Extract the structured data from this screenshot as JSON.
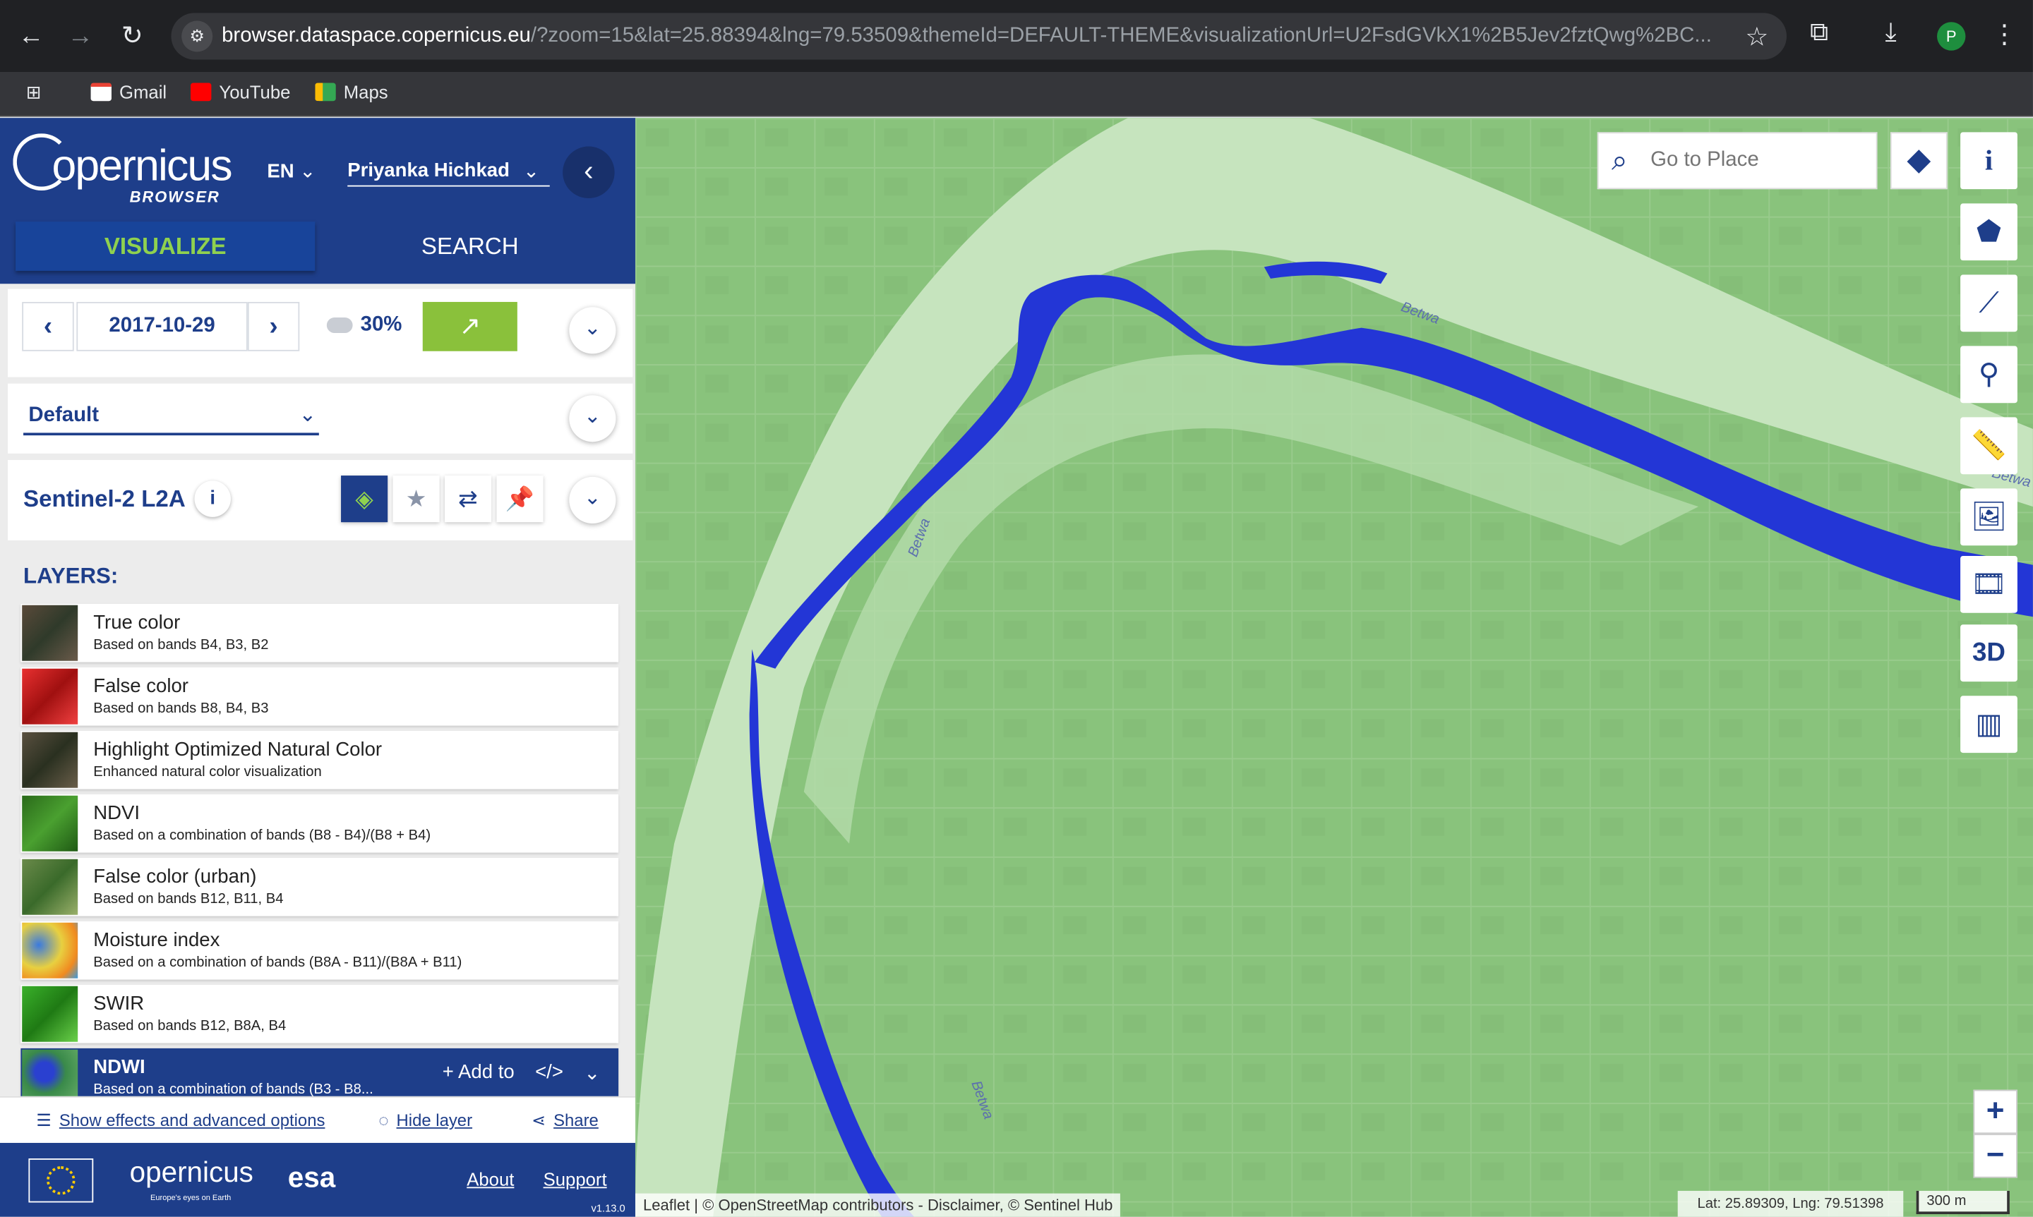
{
  "browser": {
    "url_host": "browser.dataspace.copernicus.eu",
    "url_path": "/?zoom=15&lat=25.88394&lng=79.53509&themeId=DEFAULT-THEME&visualizationUrl=U2FsdGVkX1%2B5Jev2fztQwg%2BC...",
    "profile_initial": "P",
    "bookmarks": [
      {
        "label": "Gmail"
      },
      {
        "label": "YouTube"
      },
      {
        "label": "Maps"
      }
    ]
  },
  "app": {
    "logo_text": "opernicus",
    "logo_sub": "BROWSER",
    "language": "EN",
    "user": "Priyanka Hichkad",
    "tabs": {
      "visualize": "VISUALIZE",
      "search": "SEARCH"
    }
  },
  "date_card": {
    "date": "2017-10-29",
    "cloud": "30%"
  },
  "theme": {
    "selected": "Default"
  },
  "dataset": {
    "title": "Sentinel-2 L2A",
    "info": "i"
  },
  "layers_heading": "LAYERS:",
  "layers": [
    {
      "name": "True color",
      "desc": "Based on bands B4, B3, B2",
      "thumb": "#4a4a3a"
    },
    {
      "name": "False color",
      "desc": "Based on bands B8, B4, B3",
      "thumb": "#d42a2a"
    },
    {
      "name": "Highlight Optimized Natural Color",
      "desc": "Enhanced natural color visualization",
      "thumb": "#4d4a3a"
    },
    {
      "name": "NDVI",
      "desc": "Based on a combination of bands (B8 - B4)/(B8 + B4)",
      "thumb": "#2f7a22"
    },
    {
      "name": "False color (urban)",
      "desc": "Based on bands B12, B11, B4",
      "thumb": "#5e8a3a"
    },
    {
      "name": "Moisture index",
      "desc": "Based on a combination of bands (B8A - B11)/(B8A + B11)",
      "thumb": "#d9b84a"
    },
    {
      "name": "SWIR",
      "desc": "Based on bands B12, B8A, B4",
      "thumb": "#3fa32b"
    }
  ],
  "selected_layer": {
    "name": "NDWI",
    "desc": "Based on a combination of bands (B3 - B8...",
    "add_to": "Add to",
    "thumb": "#2d7a3a"
  },
  "bottom_links": {
    "effects": "Show effects and advanced options",
    "hide": "Hide layer",
    "share": "Share"
  },
  "footer": {
    "brand": "opernicus",
    "brand_sub": "Europe's eyes on Earth",
    "esa": "esa",
    "about": "About",
    "support": "Support",
    "version": "v1.13.0"
  },
  "map": {
    "search_placeholder": "Go to Place",
    "tool_3d": "3D",
    "zoom_in": "+",
    "zoom_out": "−",
    "attribution": "Leaflet | © OpenStreetMap contributors - Disclaimer, © Sentinel Hub",
    "coords": "Lat: 25.89309, Lng: 79.51398",
    "scale": "300 m",
    "river_labels": [
      "Betwa",
      "Betwa",
      "Betwa",
      "Betwa"
    ]
  }
}
